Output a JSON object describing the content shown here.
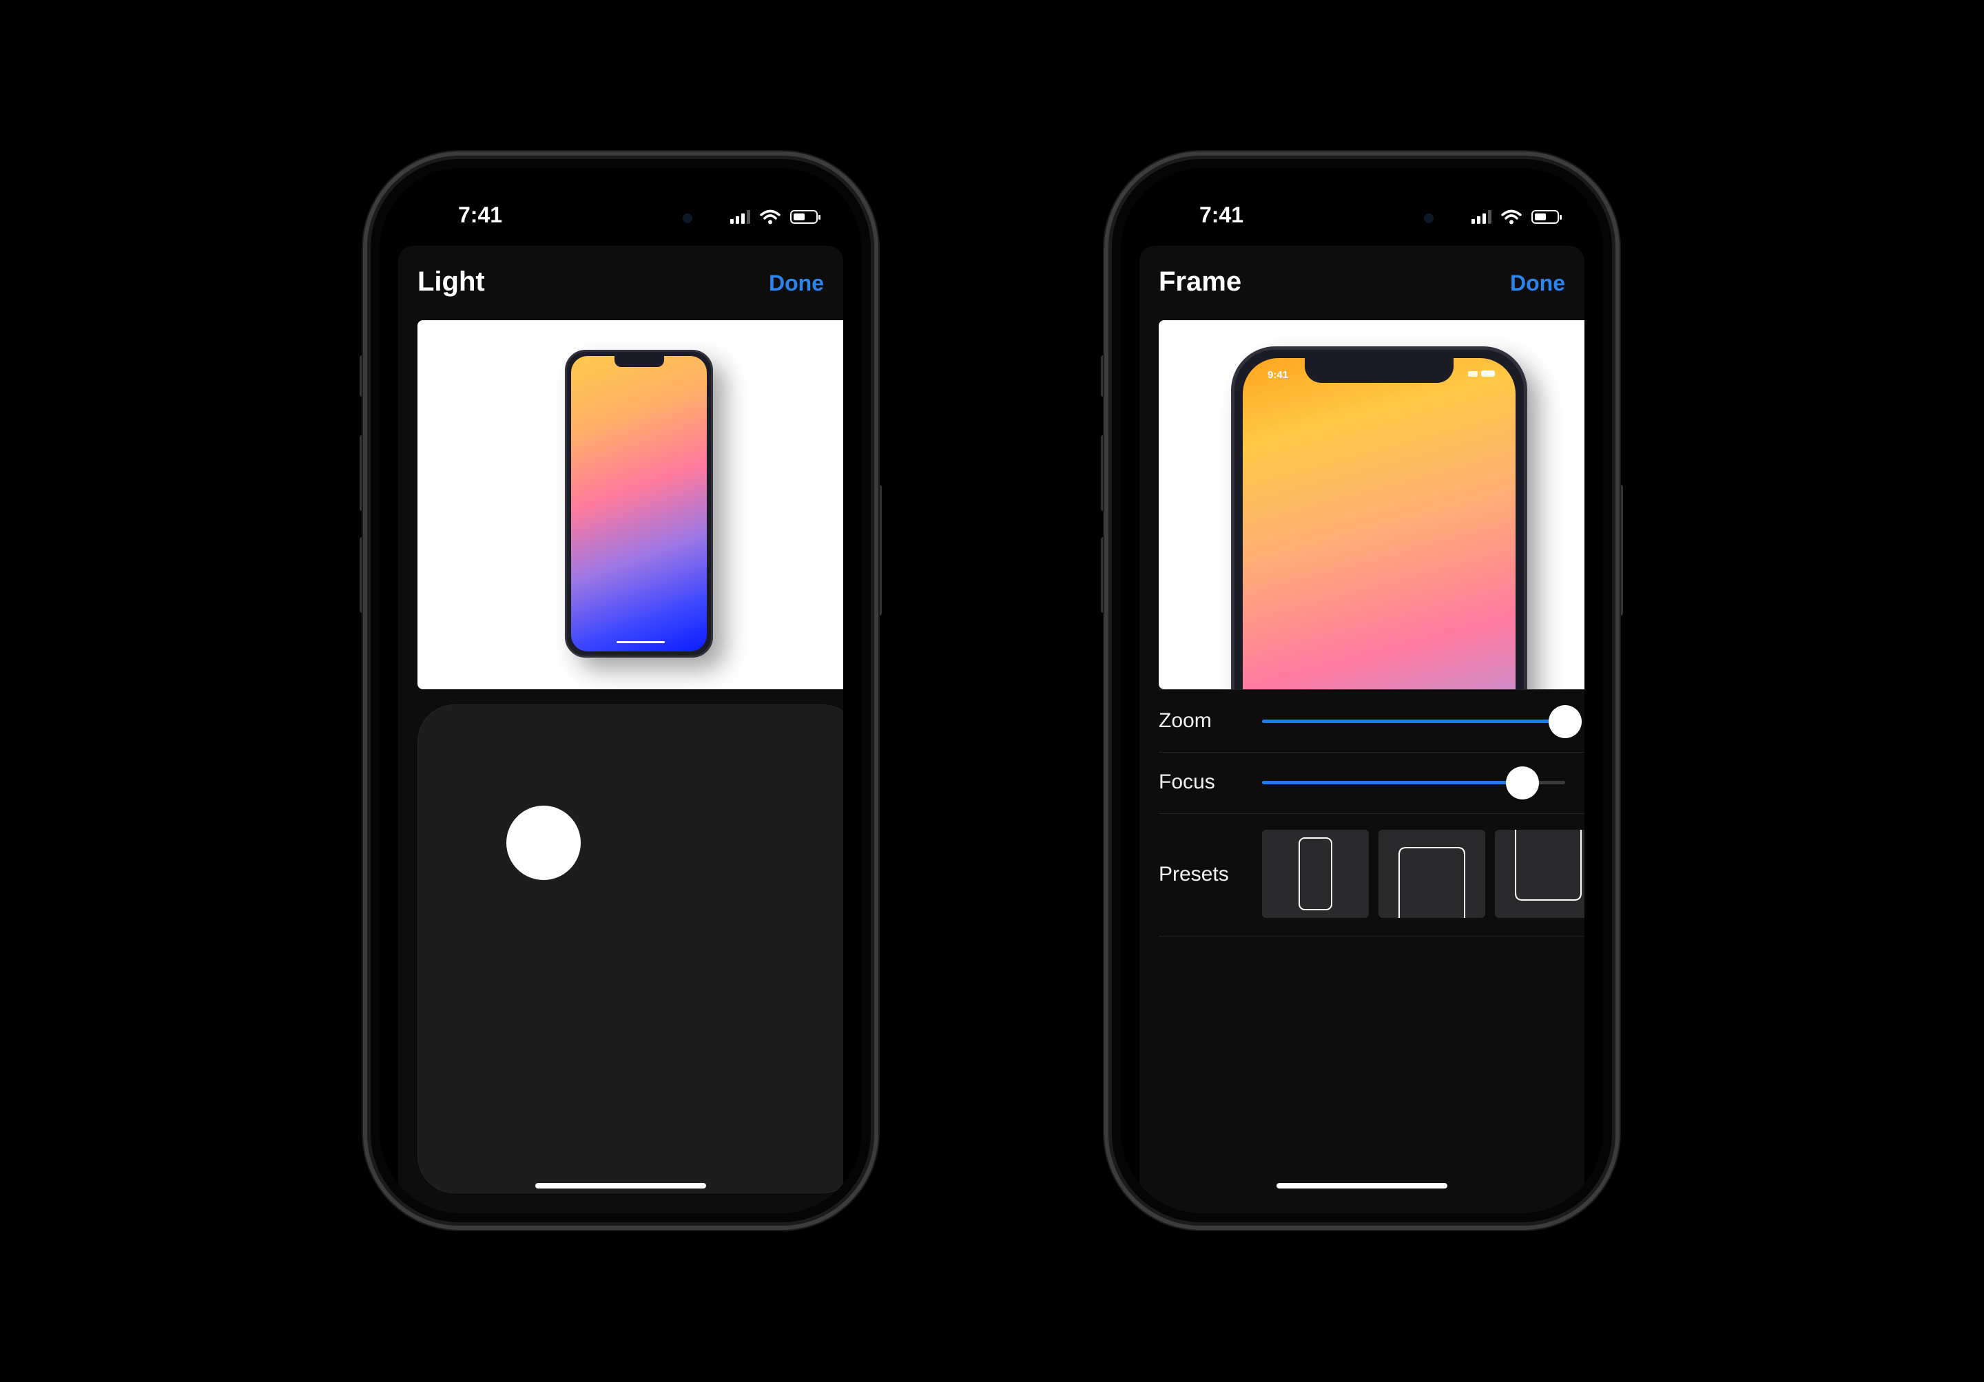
{
  "phones": [
    {
      "status": {
        "time": "7:41"
      },
      "sheet": {
        "title": "Light",
        "done_label": "Done"
      },
      "preview": {
        "status_time": ""
      }
    },
    {
      "status": {
        "time": "7:41"
      },
      "sheet": {
        "title": "Frame",
        "done_label": "Done"
      },
      "preview": {
        "status_time": "9:41"
      },
      "controls": {
        "zoom": {
          "label": "Zoom",
          "value_percent": 100
        },
        "focus": {
          "label": "Focus",
          "value_percent": 86
        },
        "presets": {
          "label": "Presets",
          "items": [
            "portrait-phone",
            "zoomed-phone",
            "close-up-phone"
          ]
        }
      }
    }
  ],
  "colors": {
    "accent": "#2c84ee",
    "slider_fill": "#1f7cf0",
    "sheet_background": "#0d0d0e",
    "pad_background": "#1d1d1e"
  }
}
